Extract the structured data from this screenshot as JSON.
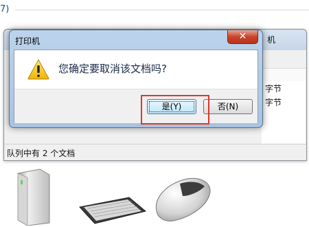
{
  "background": {
    "top_partial_text": "7)",
    "window_title_partial": "机",
    "list_items": [
      "字节",
      "字节"
    ],
    "status_text": "队列中有 2 个文档"
  },
  "dialog": {
    "title": "打印机",
    "close_symbol": "✕",
    "icon": "warning-icon",
    "message": "您确定要取消该文档吗?",
    "buttons": {
      "yes": "是(Y)",
      "no": "否(N)"
    }
  },
  "highlight_color": "#e0352b",
  "devices": [
    "external-drive-icon",
    "keyboard-icon",
    "mouse-icon"
  ]
}
